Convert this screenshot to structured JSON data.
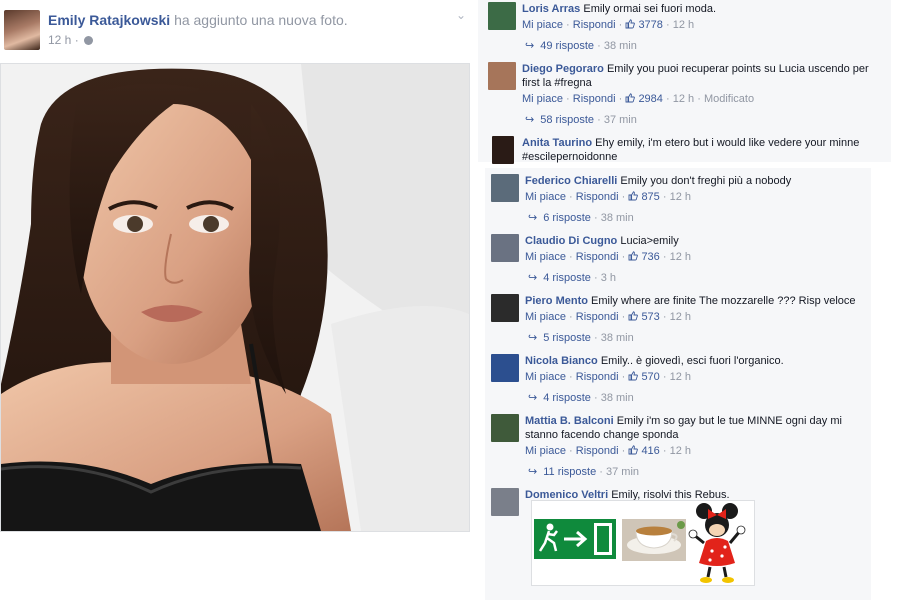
{
  "post": {
    "author": "Emily Ratajkowski",
    "action": "ha aggiunto una nuova foto.",
    "time": "12 h",
    "icons": {
      "audience": "globe-icon",
      "menu": "chevron-down-icon"
    }
  },
  "strings": {
    "like": "Mi piace",
    "reply": "Rispondi",
    "sep": "·"
  },
  "colors": {
    "link": "#3b5998",
    "meta": "#9197a3",
    "panel": "#f6f7f9"
  },
  "comments": [
    {
      "name": "Loris Arras",
      "text": "Emily ormai sei fuori moda.",
      "likes": "3778",
      "time": "12 h",
      "edited": "",
      "replies": "49 risposte",
      "reply_time": "38 min"
    },
    {
      "name": "Diego Pegoraro",
      "text": "Emily you puoi recuperar points su Lucia uscendo per first la #fregna",
      "likes": "2984",
      "time": "12 h",
      "edited": "Modificato",
      "replies": "58 risposte",
      "reply_time": "37 min"
    },
    {
      "name": "Anita Taurino",
      "text": "Ehy emily, i'm etero but i would like vedere your minne #escilepernoidonne"
    },
    {
      "name": "Federico Chiarelli",
      "text": "Emily you don't freghi più a nobody",
      "likes": "875",
      "time": "12 h",
      "edited": "",
      "replies": "6 risposte",
      "reply_time": "38 min"
    },
    {
      "name": "Claudio Di Cugno",
      "text": "Lucia>emily",
      "likes": "736",
      "time": "12 h",
      "edited": "",
      "replies": "4 risposte",
      "reply_time": "3 h"
    },
    {
      "name": "Piero Mento",
      "text": "Emily where are finite The mozzarelle ??? Risp veloce",
      "likes": "573",
      "time": "12 h",
      "edited": "",
      "replies": "5 risposte",
      "reply_time": "38 min"
    },
    {
      "name": "Nicola Bianco",
      "text": "Emily.. è giovedì, esci fuori l'organico.",
      "likes": "570",
      "time": "12 h",
      "edited": "",
      "replies": "4 risposte",
      "reply_time": "38 min"
    },
    {
      "name": "Mattia B. Balconi",
      "text": "Emily i'm so gay but le tue MINNE ogni day mi stanno facendo change sponda",
      "likes": "416",
      "time": "12 h",
      "edited": "",
      "replies": "11 risposte",
      "reply_time": "37 min"
    },
    {
      "name": "Domenico Veltri",
      "text": "Emily, risolvi this Rebus."
    }
  ]
}
